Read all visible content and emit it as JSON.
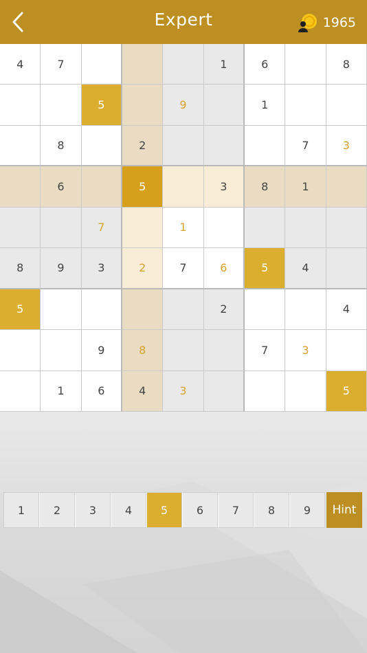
{
  "header": {
    "title": "Expert",
    "coins": "1965",
    "back_icon": "chevron-left-icon",
    "coin_icon": "coin-user-icon"
  },
  "board": {
    "rows": [
      [
        "4",
        "7",
        "",
        "",
        "",
        "1",
        "6",
        "",
        "8"
      ],
      [
        "",
        "",
        "5",
        "",
        "9",
        "",
        "1",
        "",
        ""
      ],
      [
        "",
        "8",
        "",
        "2",
        "",
        "",
        "",
        "7",
        "3"
      ],
      [
        "",
        "6",
        "",
        "5",
        "",
        "3",
        "8",
        "1",
        ""
      ],
      [
        "",
        "",
        "7",
        "",
        "1",
        "",
        "",
        "",
        ""
      ],
      [
        "8",
        "9",
        "3",
        "2",
        "7",
        "6",
        "5",
        "4",
        ""
      ],
      [
        "5",
        "",
        "",
        "",
        "",
        "2",
        "",
        "",
        "4"
      ],
      [
        "",
        "",
        "9",
        "8",
        "",
        "",
        "7",
        "3",
        ""
      ],
      [
        "",
        "1",
        "6",
        "4",
        "3",
        "",
        "",
        "",
        "5"
      ]
    ],
    "styles": [
      [
        "plain",
        "plain",
        "plain",
        "tan",
        "grey",
        "grey",
        "plain",
        "plain",
        "plain"
      ],
      [
        "plain",
        "plain",
        "gold",
        "tan",
        "grey",
        "grey",
        "plain",
        "plain",
        "plain"
      ],
      [
        "plain",
        "plain",
        "plain",
        "tan",
        "grey",
        "grey",
        "plain",
        "plain",
        "plain"
      ],
      [
        "tan",
        "tan",
        "tan",
        "goldsel",
        "cream",
        "cream",
        "tan",
        "tan",
        "tan"
      ],
      [
        "grey",
        "grey",
        "grey",
        "cream",
        "plain",
        "plain",
        "grey",
        "grey",
        "grey"
      ],
      [
        "grey",
        "grey",
        "grey",
        "cream",
        "plain",
        "plain",
        "gold",
        "grey",
        "grey"
      ],
      [
        "gold",
        "plain",
        "plain",
        "tan",
        "grey",
        "grey",
        "plain",
        "plain",
        "plain"
      ],
      [
        "plain",
        "plain",
        "plain",
        "tan",
        "grey",
        "grey",
        "plain",
        "plain",
        "plain"
      ],
      [
        "plain",
        "plain",
        "plain",
        "tan",
        "grey",
        "grey",
        "plain",
        "plain",
        "gold"
      ]
    ],
    "user_entered": [
      [
        0,
        0,
        0,
        0,
        0,
        0,
        0,
        0,
        0
      ],
      [
        0,
        0,
        1,
        0,
        1,
        0,
        0,
        0,
        0
      ],
      [
        0,
        0,
        0,
        0,
        0,
        0,
        0,
        0,
        1
      ],
      [
        0,
        0,
        0,
        0,
        0,
        0,
        0,
        0,
        0
      ],
      [
        0,
        0,
        1,
        0,
        1,
        0,
        0,
        0,
        0
      ],
      [
        0,
        0,
        0,
        1,
        0,
        1,
        0,
        0,
        0
      ],
      [
        0,
        0,
        0,
        0,
        0,
        0,
        0,
        0,
        0
      ],
      [
        0,
        0,
        0,
        1,
        0,
        0,
        0,
        1,
        0
      ],
      [
        0,
        0,
        0,
        0,
        1,
        0,
        0,
        0,
        0
      ]
    ]
  },
  "numpad": {
    "keys": [
      "1",
      "2",
      "3",
      "4",
      "5",
      "6",
      "7",
      "8",
      "9"
    ],
    "selected": "5",
    "hint_label": "Hint"
  },
  "colors": {
    "header": "#bd8e22",
    "highlight": "#dcae30",
    "user_digit": "#d7a331"
  }
}
